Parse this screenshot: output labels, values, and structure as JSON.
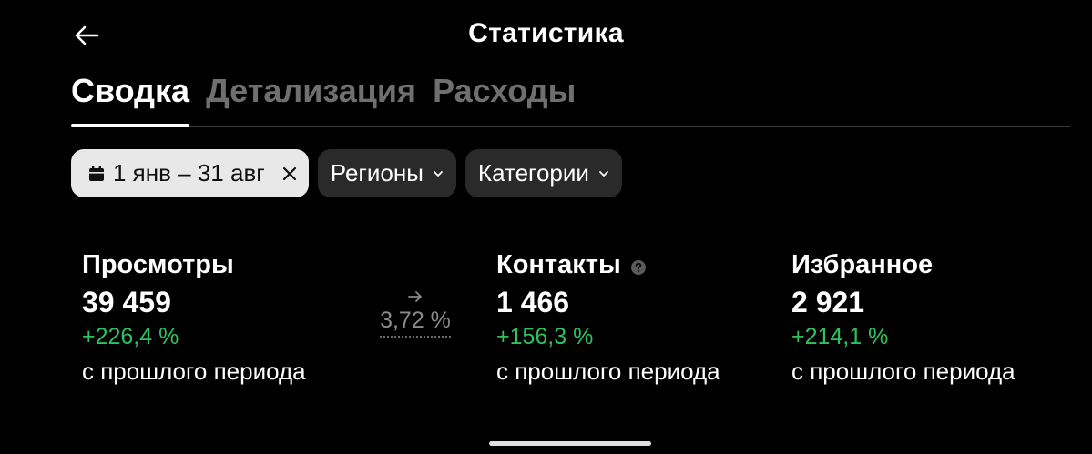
{
  "header": {
    "title": "Статистика"
  },
  "tabs": [
    {
      "label": "Сводка",
      "active": true
    },
    {
      "label": "Детализация",
      "active": false
    },
    {
      "label": "Расходы",
      "active": false
    }
  ],
  "filters": {
    "date_range": "1 янв – 31 авг",
    "regions": "Регионы",
    "categories": "Категории"
  },
  "metrics": [
    {
      "label": "Просмотры",
      "value": "39 459",
      "change": "+226,4 %",
      "sub": "с прошлого периода"
    },
    {
      "label": "Контакты",
      "value": "1 466",
      "change": "+156,3 %",
      "sub": "с прошлого периода"
    },
    {
      "label": "Избранное",
      "value": "2 921",
      "change": "+214,1 %",
      "sub": "с прошлого периода"
    }
  ],
  "conversion": {
    "value": "3,72 %"
  },
  "colors": {
    "background": "#000000",
    "positive": "#2fc25b",
    "chip": "#2a2a2a",
    "chip_active": "#e8e8e8",
    "tab_inactive": "#6f6f6f"
  },
  "icons": {
    "back": "arrow-left-icon",
    "calendar": "calendar-icon",
    "close": "close-icon",
    "chevron": "chevron-down-icon",
    "help": "help-circle-icon",
    "arrow": "arrow-right-icon"
  }
}
